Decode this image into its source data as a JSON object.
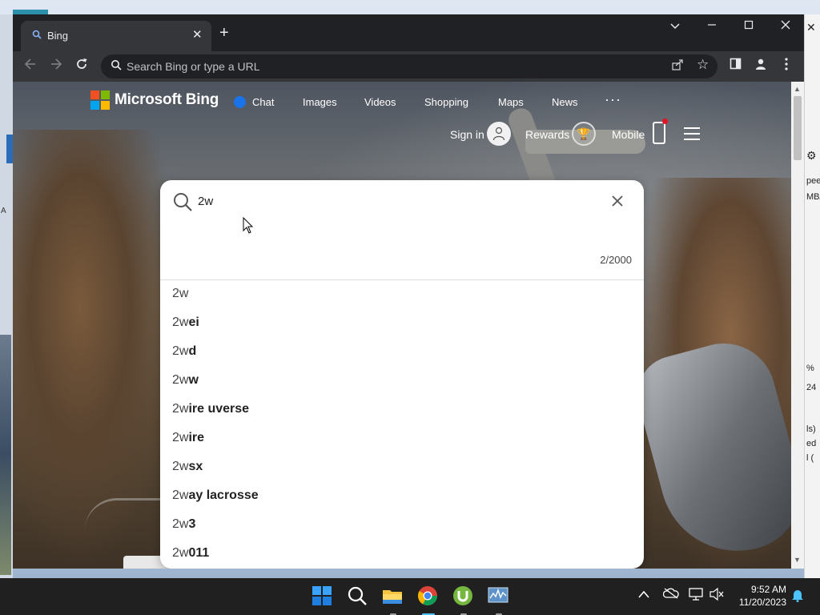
{
  "browser": {
    "tab_title": "Bing",
    "new_tab_symbol": "+",
    "close_tab_symbol": "✕",
    "omnibox_placeholder": "Search Bing or type a URL"
  },
  "bing": {
    "logo_text": "Microsoft Bing",
    "nav": {
      "chat": "Chat",
      "images": "Images",
      "videos": "Videos",
      "shopping": "Shopping",
      "maps": "Maps",
      "news": "News",
      "more": "···"
    },
    "header": {
      "sign_in": "Sign in",
      "rewards": "Rewards",
      "mobile": "Mobile"
    }
  },
  "search": {
    "query": "2w",
    "char_counter": "2/2000",
    "suggestions": [
      {
        "prefix": "2w",
        "completion": ""
      },
      {
        "prefix": "2w",
        "completion": "ei"
      },
      {
        "prefix": "2w",
        "completion": "d"
      },
      {
        "prefix": "2w",
        "completion": "w"
      },
      {
        "prefix": "2w",
        "completion": "ire uverse"
      },
      {
        "prefix": "2w",
        "completion": "ire"
      },
      {
        "prefix": "2w",
        "completion": "sx"
      },
      {
        "prefix": "2w",
        "completion": "ay lacrosse"
      },
      {
        "prefix": "2w",
        "completion": "3"
      },
      {
        "prefix": "2w",
        "completion": "011"
      }
    ]
  },
  "desktop_fragments": {
    "right": [
      "peed",
      "MB/",
      "%",
      "24",
      "ls)",
      "ed",
      "l ("
    ],
    "left": [
      "A"
    ]
  },
  "taskbar": {
    "time": "9:52 AM",
    "date": "11/20/2023",
    "apps": [
      "windows-start",
      "search",
      "file-explorer",
      "chrome",
      "utorrent",
      "resource-monitor"
    ]
  },
  "colors": {
    "chrome_dark": "#202124",
    "chrome_toolbar": "#35363a",
    "bing_chat_blue": "#1a73e8",
    "taskbar": "#202020",
    "active_indicator": "#4cc2ff"
  }
}
